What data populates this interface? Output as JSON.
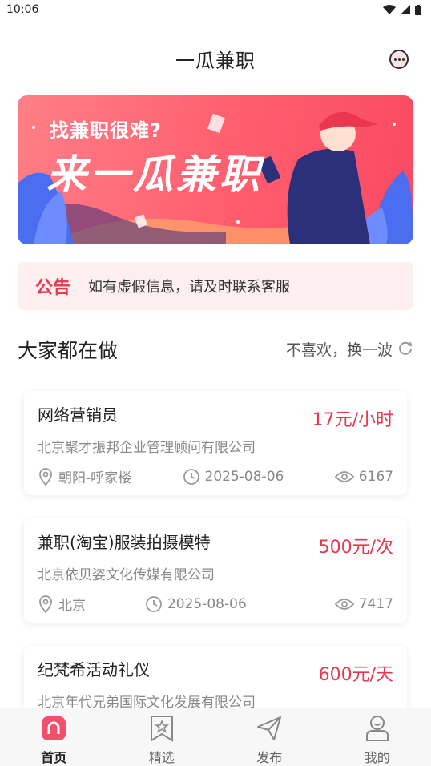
{
  "status_bar": {
    "time": "10:06"
  },
  "header": {
    "title": "一瓜兼职"
  },
  "banner": {
    "subtitle": "找兼职很难?",
    "headline": "来一瓜兼职"
  },
  "notice": {
    "tag": "公告",
    "text": "如有虚假信息，请及时联系客服"
  },
  "section": {
    "title": "大家都在做",
    "refresh_label": "不喜欢，换一波"
  },
  "jobs": [
    {
      "title": "网络营销员",
      "price": "17元/小时",
      "company": "北京聚才振邦企业管理顾问有限公司",
      "location": "朝阳-呼家楼",
      "date": "2025-08-06",
      "views": "6167"
    },
    {
      "title": "兼职(淘宝)服装拍摄模特",
      "price": "500元/次",
      "company": "北京依贝姿文化传媒有限公司",
      "location": "北京",
      "date": "2025-08-06",
      "views": "7417"
    },
    {
      "title": "纪梵希活动礼仪",
      "price": "600元/天",
      "company": "北京年代兄弟国际文化发展有限公司",
      "location": "",
      "date": "",
      "views": ""
    }
  ],
  "tabs": [
    {
      "label": "首页",
      "icon": "home-icon",
      "active": true
    },
    {
      "label": "精选",
      "icon": "bookmark-star-icon",
      "active": false
    },
    {
      "label": "发布",
      "icon": "send-icon",
      "active": false
    },
    {
      "label": "我的",
      "icon": "user-icon",
      "active": false
    }
  ],
  "colors": {
    "accent": "#e8374f",
    "banner": "#ff5d6e",
    "notice_bg": "#fdeff0"
  }
}
